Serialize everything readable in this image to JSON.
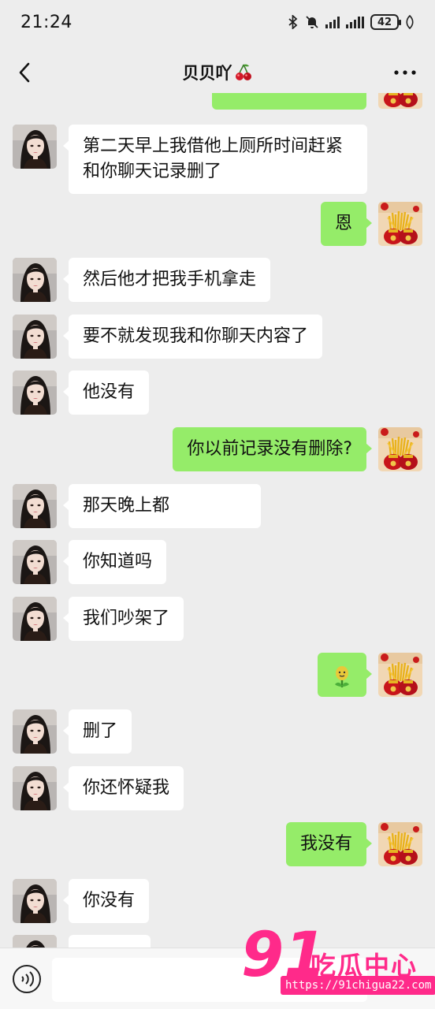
{
  "status_bar": {
    "time": "21:24",
    "battery": "42"
  },
  "header": {
    "title": "贝贝吖"
  },
  "messages": [
    {
      "side": "out",
      "text": ""
    },
    {
      "side": "in",
      "text": "第二天早上我借他上厕所时间赶紧和你聊天记录删了"
    },
    {
      "side": "out",
      "text": "恩"
    },
    {
      "side": "in",
      "text": "然后他才把我手机拿走"
    },
    {
      "side": "in",
      "text": "要不就发现我和你聊天内容了"
    },
    {
      "side": "in",
      "text": "他没有"
    },
    {
      "side": "out",
      "text": "你以前记录没有删除?"
    },
    {
      "side": "in",
      "text": "那天晚上都"
    },
    {
      "side": "in",
      "text": "你知道吗"
    },
    {
      "side": "in",
      "text": "我们吵架了"
    },
    {
      "side": "out",
      "text": "",
      "emoji": "tulip-emoji"
    },
    {
      "side": "in",
      "text": "删了"
    },
    {
      "side": "in",
      "text": "你还怀疑我"
    },
    {
      "side": "out",
      "text": "我没有"
    },
    {
      "side": "in",
      "text": "你没有"
    }
  ],
  "watermark": {
    "number": "91",
    "name": "吃瓜中心",
    "url": "https://91chigua22.com"
  },
  "colors": {
    "background": "#ededed",
    "bubble_out": "#95ec69",
    "bubble_in": "#ffffff",
    "watermark": "#ff2a8a"
  }
}
